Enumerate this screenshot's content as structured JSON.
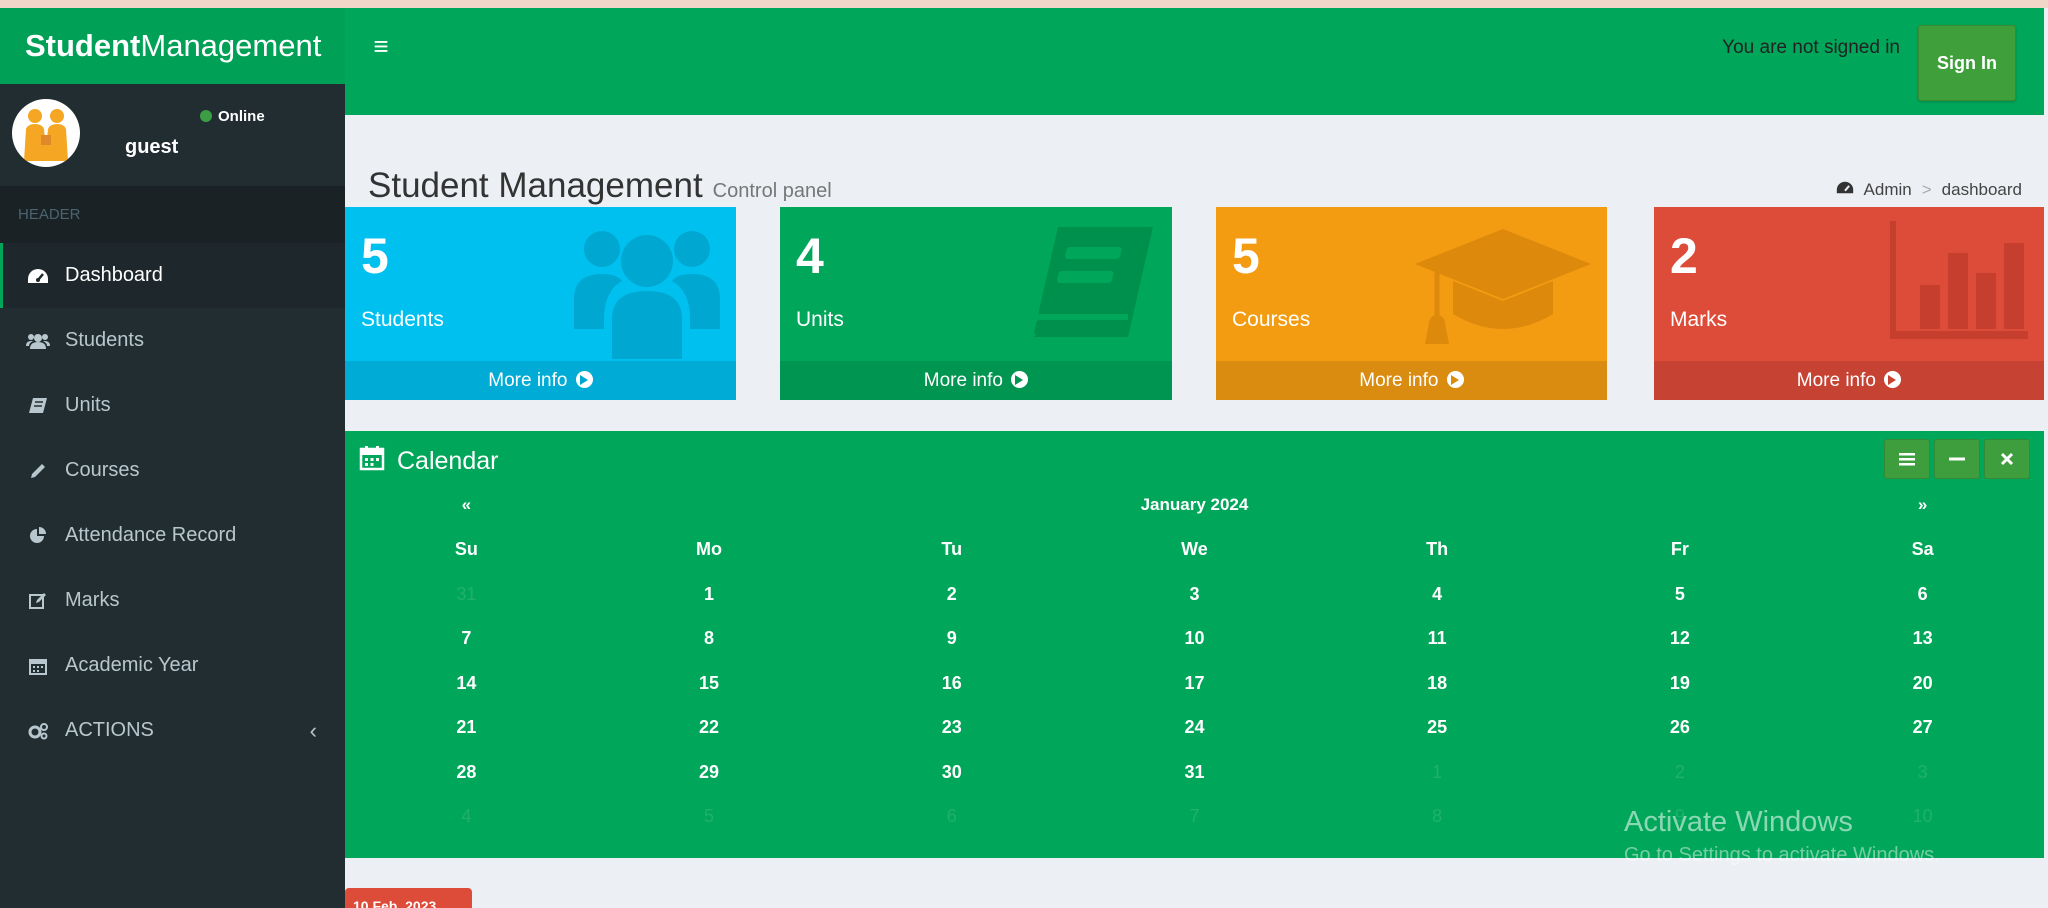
{
  "header": {
    "logo_bold": "Student",
    "logo_rest": "Management",
    "menu_toggle": "≡",
    "not_signed_text": "You are not signed in",
    "signin_label": "Sign In"
  },
  "sidebar": {
    "user": {
      "name": "guest",
      "status": "Online"
    },
    "header_label": "HEADER",
    "items": [
      {
        "label": "Dashboard",
        "icon": "dashboard-icon",
        "active": true
      },
      {
        "label": "Students",
        "icon": "users-icon"
      },
      {
        "label": "Units",
        "icon": "book-icon"
      },
      {
        "label": "Courses",
        "icon": "pencil-icon"
      },
      {
        "label": "Attendance Record",
        "icon": "pie-chart-icon"
      },
      {
        "label": "Marks",
        "icon": "edit-icon"
      },
      {
        "label": "Academic Year",
        "icon": "calendar-icon"
      },
      {
        "label": "ACTIONS",
        "icon": "gears-icon",
        "chevron": "‹"
      }
    ]
  },
  "content": {
    "title": "Student Management",
    "subtitle": "Control panel",
    "breadcrumb": {
      "home": "Admin",
      "sep": ">",
      "current": "dashboard"
    }
  },
  "stat_boxes": [
    {
      "value": "5",
      "label": "Students",
      "footer": "More info",
      "color": "#00c0ef",
      "icon": "users-icon"
    },
    {
      "value": "4",
      "label": "Units",
      "footer": "More info",
      "color": "#00a65a",
      "icon": "book-icon"
    },
    {
      "value": "5",
      "label": "Courses",
      "footer": "More info",
      "color": "#f39c12",
      "icon": "graduation-cap-icon"
    },
    {
      "value": "2",
      "label": "Marks",
      "footer": "More info",
      "color": "#dd4b39",
      "icon": "bar-chart-icon"
    }
  ],
  "calendar": {
    "title": "Calendar",
    "month": "January 2024",
    "prev": "«",
    "next": "»",
    "weekdays": [
      "Su",
      "Mo",
      "Tu",
      "We",
      "Th",
      "Fr",
      "Sa"
    ],
    "weeks": [
      [
        "31",
        "1",
        "2",
        "3",
        "4",
        "5",
        "6"
      ],
      [
        "7",
        "8",
        "9",
        "10",
        "11",
        "12",
        "13"
      ],
      [
        "14",
        "15",
        "16",
        "17",
        "18",
        "19",
        "20"
      ],
      [
        "21",
        "22",
        "23",
        "24",
        "25",
        "26",
        "27"
      ],
      [
        "28",
        "29",
        "30",
        "31",
        "1",
        "2",
        "3"
      ],
      [
        "4",
        "5",
        "6",
        "7",
        "8",
        "9",
        "10"
      ]
    ]
  },
  "watermark": {
    "line1": "Activate Windows",
    "line2": "Go to Settings to activate Windows."
  },
  "date_badge": "10 Feb. 2023",
  "colors": {
    "brand_green": "#00a65a",
    "sidebar_bg": "#222d32",
    "aqua": "#00c0ef",
    "orange": "#f39c12",
    "red": "#dd4b39"
  }
}
